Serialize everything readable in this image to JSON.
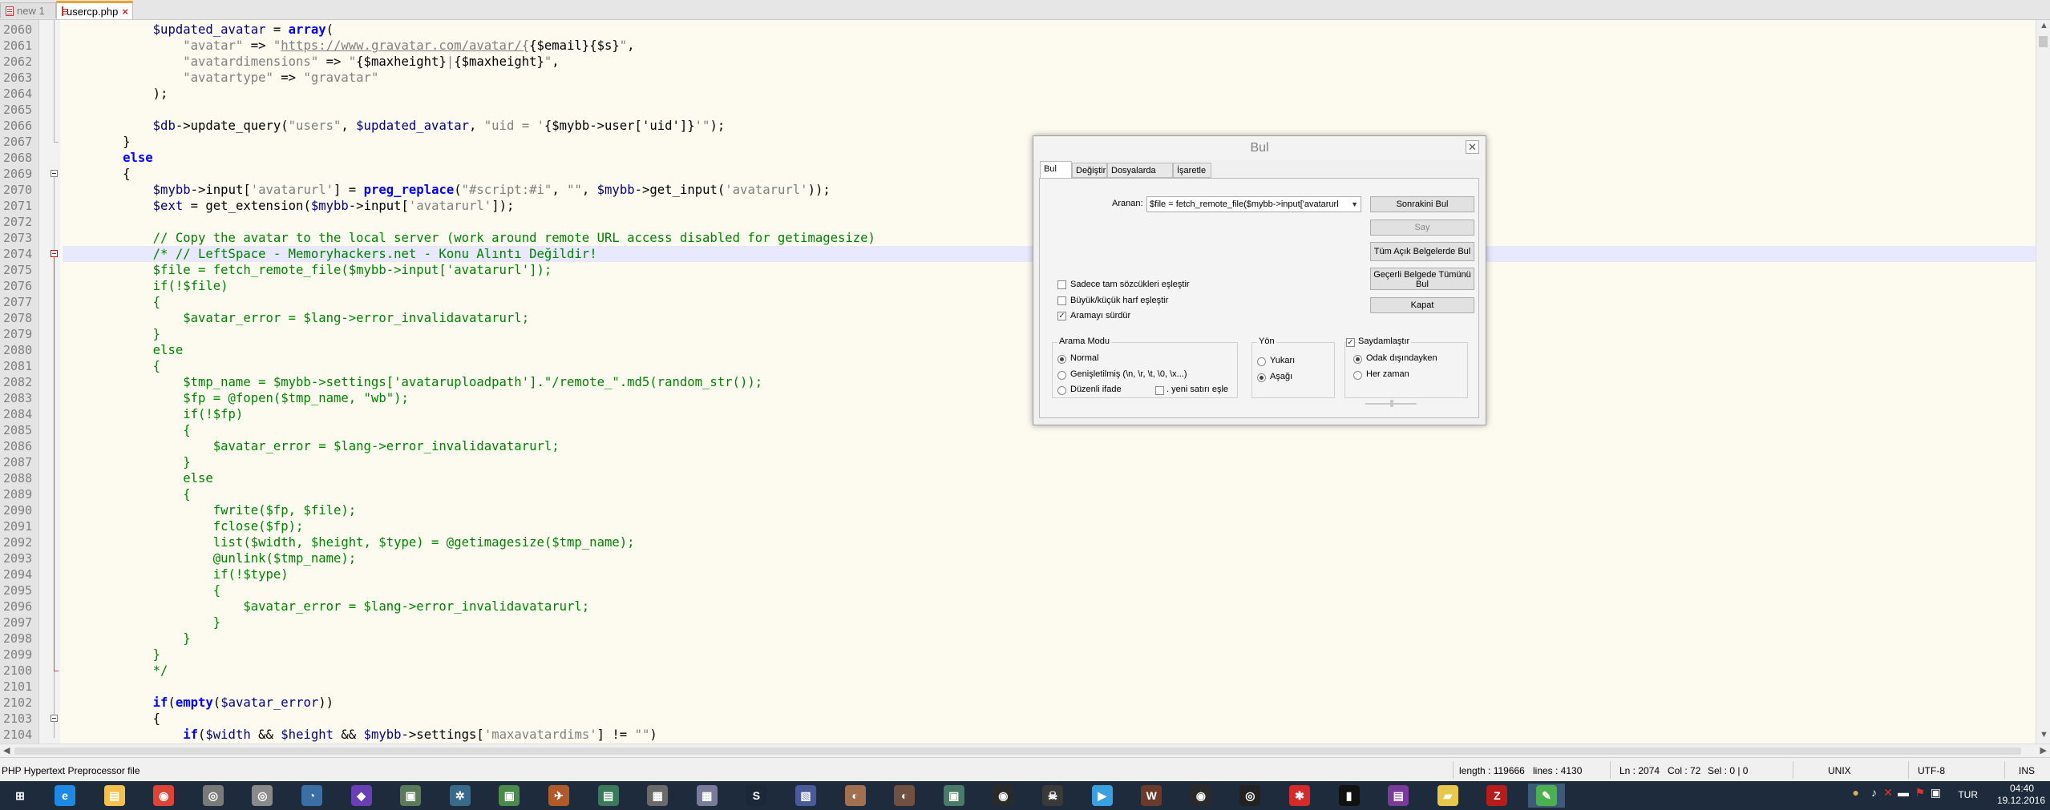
{
  "tabs": [
    {
      "label": "new 1",
      "active": false
    },
    {
      "label": "usercp.php",
      "active": true
    }
  ],
  "editor": {
    "lines": [
      {
        "num": "2060",
        "html": "            <span class='v'>$updated_avatar</span> = <span class='k'>array</span>("
      },
      {
        "num": "2061",
        "html": "                <span class='s'>\"avatar\"</span> => <span class='s'>\"<u>https://www.gravatar.com/avatar/{</u></span>{$email}{$s}<span class='s'>\"</span>,"
      },
      {
        "num": "2062",
        "html": "                <span class='s'>\"avatardimensions\"</span> => <span class='s'>\"</span>{$maxheight}<span class='s'>|</span>{$maxheight}<span class='s'>\"</span>,"
      },
      {
        "num": "2063",
        "html": "                <span class='s'>\"avatartype\"</span> => <span class='s'>\"gravatar\"</span>"
      },
      {
        "num": "2064",
        "html": "            );"
      },
      {
        "num": "2065",
        "html": ""
      },
      {
        "num": "2066",
        "html": "            <span class='v'>$db</span>->update_query(<span class='s'>\"users\"</span>, <span class='v'>$updated_avatar</span>, <span class='s'>\"uid = '</span>{$mybb->user['uid']}<span class='s'>'\"</span>);"
      },
      {
        "num": "2067",
        "html": "        }"
      },
      {
        "num": "2068",
        "html": "        <span class='k'>else</span>"
      },
      {
        "num": "2069",
        "html": "        {"
      },
      {
        "num": "2070",
        "html": "            <span class='v'>$mybb</span>->input[<span class='s'>'avatarurl'</span>] = <span class='k'>preg_replace</span>(<span class='s'>\"#script:#i\"</span>, <span class='s'>\"\"</span>, <span class='v'>$mybb</span>->get_input(<span class='s'>'avatarurl'</span>));"
      },
      {
        "num": "2071",
        "html": "            <span class='v'>$ext</span> = get_extension(<span class='v'>$mybb</span>->input[<span class='s'>'avatarurl'</span>]);"
      },
      {
        "num": "2072",
        "html": ""
      },
      {
        "num": "2073",
        "html": "            <span class='c'>// Copy the avatar to the local server (work around remote URL access disabled for getimagesize)</span>"
      },
      {
        "num": "2074",
        "html": "            <span class='c'>/* // LeftSpace - Memoryhackers.net - Konu Alıntı Değildir!</span>"
      },
      {
        "num": "2075",
        "html": "            <span class='c'>$file = fetch_remote_file($mybb->input['avatarurl']);</span>"
      },
      {
        "num": "2076",
        "html": "            <span class='c'>if(!$file)</span>"
      },
      {
        "num": "2077",
        "html": "            <span class='c'>{</span>"
      },
      {
        "num": "2078",
        "html": "                <span class='c'>$avatar_error = $lang->error_invalidavatarurl;</span>"
      },
      {
        "num": "2079",
        "html": "            <span class='c'>}</span>"
      },
      {
        "num": "2080",
        "html": "            <span class='c'>else</span>"
      },
      {
        "num": "2081",
        "html": "            <span class='c'>{</span>"
      },
      {
        "num": "2082",
        "html": "                <span class='c'>$tmp_name = $mybb->settings['avataruploadpath'].\"/remote_\".md5(random_str());</span>"
      },
      {
        "num": "2083",
        "html": "                <span class='c'>$fp = @fopen($tmp_name, \"wb\");</span>"
      },
      {
        "num": "2084",
        "html": "                <span class='c'>if(!$fp)</span>"
      },
      {
        "num": "2085",
        "html": "                <span class='c'>{</span>"
      },
      {
        "num": "2086",
        "html": "                    <span class='c'>$avatar_error = $lang->error_invalidavatarurl;</span>"
      },
      {
        "num": "2087",
        "html": "                <span class='c'>}</span>"
      },
      {
        "num": "2088",
        "html": "                <span class='c'>else</span>"
      },
      {
        "num": "2089",
        "html": "                <span class='c'>{</span>"
      },
      {
        "num": "2090",
        "html": "                    <span class='c'>fwrite($fp, $file);</span>"
      },
      {
        "num": "2091",
        "html": "                    <span class='c'>fclose($fp);</span>"
      },
      {
        "num": "2092",
        "html": "                    <span class='c'>list($width, $height, $type) = @getimagesize($tmp_name);</span>"
      },
      {
        "num": "2093",
        "html": "                    <span class='c'>@unlink($tmp_name);</span>"
      },
      {
        "num": "2094",
        "html": "                    <span class='c'>if(!$type)</span>"
      },
      {
        "num": "2095",
        "html": "                    <span class='c'>{</span>"
      },
      {
        "num": "2096",
        "html": "                        <span class='c'>$avatar_error = $lang->error_invalidavatarurl;</span>"
      },
      {
        "num": "2097",
        "html": "                    <span class='c'>}</span>"
      },
      {
        "num": "2098",
        "html": "                <span class='c'>}</span>"
      },
      {
        "num": "2099",
        "html": "            <span class='c'>}</span>"
      },
      {
        "num": "2100",
        "html": "            <span class='c'>*/</span>"
      },
      {
        "num": "2101",
        "html": ""
      },
      {
        "num": "2102",
        "html": "            <span class='k'>if</span>(<span class='k'>empty</span>(<span class='v'>$avatar_error</span>))"
      },
      {
        "num": "2103",
        "html": "            {"
      },
      {
        "num": "2104",
        "html": "                <span class='k'>if</span>(<span class='v'>$width</span> && <span class='v'>$height</span> && <span class='v'>$mybb</span>->settings[<span class='s'>'maxavatardims'</span>] != <span class='s'>\"\"</span>)"
      }
    ],
    "current_line": "2074"
  },
  "status": {
    "file_type": "PHP Hypertext Preprocessor file",
    "length": "length : 119666",
    "lines": "lines : 4130",
    "ln": "Ln : 2074",
    "col": "Col : 72",
    "sel": "Sel : 0 | 0",
    "eol": "UNIX",
    "encoding": "UTF-8",
    "mode": "INS"
  },
  "dialog": {
    "title": "Bul",
    "close": "✕",
    "tabs": [
      "Bul",
      "Değiştir",
      "Dosyalarda Bul",
      "İşaretle"
    ],
    "search_label": "Aranan:",
    "search_value": "$file = fetch_remote_file($mybb->input['avatarurl",
    "buttons": {
      "find_next": "Sonrakini Bul",
      "count": "Say",
      "find_all_open": "Tüm Açık Belgelerde Bul",
      "find_all_current": "Geçerli Belgede Tümünü Bul",
      "close": "Kapat"
    },
    "checks": {
      "whole_word": "Sadece tam sözcükleri eşleştir",
      "match_case": "Büyük/küçük harf eşleştir",
      "wrap": "Aramayı sürdür"
    },
    "search_mode": {
      "title": "Arama Modu",
      "normal": "Normal",
      "extended": "Genişletilmiş (\\n, \\r, \\t, \\0, \\x...)",
      "regex": "Düzenli ifade",
      "newline": ". yeni satırı eşle"
    },
    "direction": {
      "title": "Yön",
      "up": "Yukarı",
      "down": "Aşağı"
    },
    "transparency": {
      "title": "Saydamlaştır",
      "on_lose_focus": "Odak dışındayken",
      "always": "Her zaman"
    }
  },
  "tray": {
    "lang": "TUR",
    "time": "04:40",
    "date": "19.12.2016"
  },
  "taskbar_icons": [
    "start-icon",
    "ie-icon",
    "explorer-icon",
    "chrome-icon",
    "app1-icon",
    "app2-icon",
    "app3-icon",
    "visual-studio-icon",
    "app4-icon",
    "app5-icon",
    "app6-icon",
    "app7-icon",
    "app8-icon",
    "app9-icon",
    "calculator-icon",
    "steam-icon",
    "app10-icon",
    "app11-icon",
    "app12-icon",
    "app13-icon",
    "app14-icon",
    "app15-icon",
    "app16-icon",
    "app17-icon",
    "app18-icon",
    "obs-icon",
    "app19-icon",
    "cmd-icon",
    "winrar-icon",
    "folder-icon",
    "filezilla-icon",
    "notepadpp-icon"
  ]
}
